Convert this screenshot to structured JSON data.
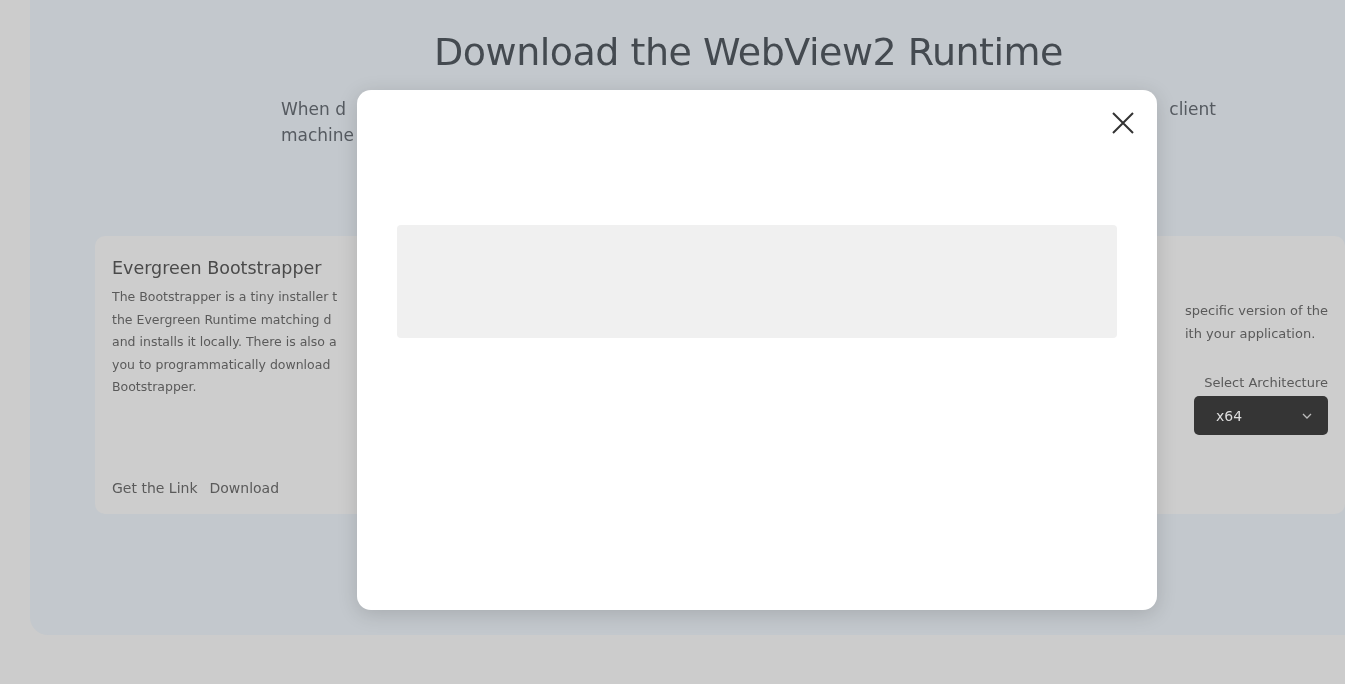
{
  "page": {
    "title": "Download the WebView2 Runtime",
    "intro_left": [
      "When d",
      "machine"
    ],
    "intro_right": [
      "client"
    ],
    "card": {
      "title": "Evergreen Bootstrapper",
      "description_lines": [
        "The Bootstrapper is a tiny installer t",
        "the Evergreen Runtime matching d",
        "and installs it locally. There is also a",
        "you to programmatically download",
        "Bootstrapper."
      ],
      "links": [
        "Get the Link",
        "Download"
      ],
      "right_description_lines": [
        "specific version of the",
        "ith your application."
      ],
      "architecture_label": "Select Architecture",
      "architecture_value": "x64"
    }
  },
  "dialog": {
    "kind": "loading"
  }
}
